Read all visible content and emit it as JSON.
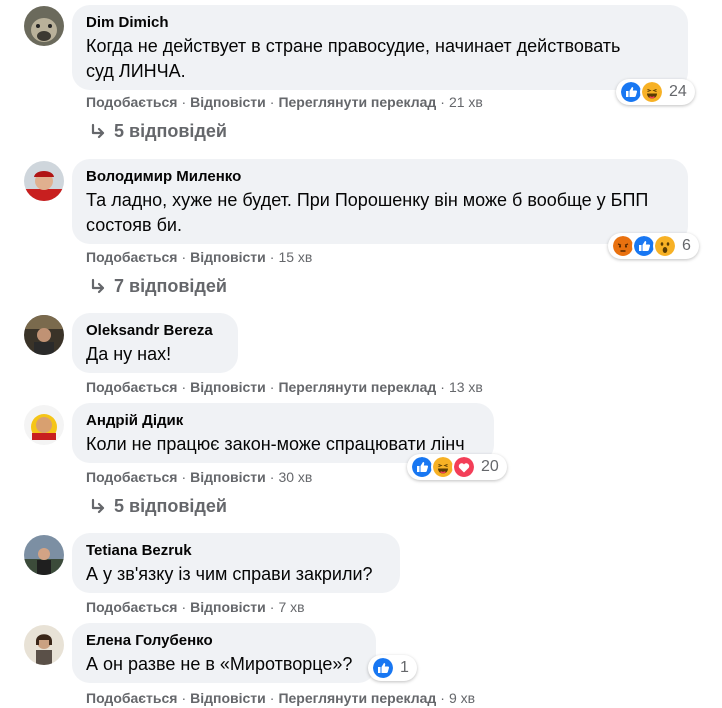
{
  "colors": {
    "bubble": "#f0f2f5",
    "secondary_text": "#65676b",
    "like_blue": "#1877f2",
    "haha_yellow": "#f7b125",
    "angry_orange": "#e9710f",
    "love_red": "#f33e58"
  },
  "comments": [
    {
      "author": "Dim Dimich",
      "text_lines": [
        "Когда не действует в стране правосудие, начинает действовать",
        "суд ЛИНЧА."
      ],
      "actions": [
        "Подобається",
        "Відповісти",
        "Переглянути переклад"
      ],
      "time": "21 хв",
      "reactions": {
        "icons": [
          "like-icon",
          "haha-icon"
        ],
        "count": "24"
      },
      "replies": "5 відповідей"
    },
    {
      "author": "Володимир Миленко",
      "text_lines": [
        "Та ладно, хуже не будет. При Порошенку він може б вообще у БПП",
        "состояв би."
      ],
      "actions": [
        "Подобається",
        "Відповісти"
      ],
      "time": "15 хв",
      "reactions": {
        "icons": [
          "angry-icon",
          "like-icon",
          "wow-icon"
        ],
        "count": "6"
      },
      "replies": "7 відповідей"
    },
    {
      "author": "Oleksandr Bereza",
      "text_lines": [
        "Да ну нах!"
      ],
      "actions": [
        "Подобається",
        "Відповісти",
        "Переглянути переклад"
      ],
      "time": "13 хв"
    },
    {
      "author": "Андрій Дідик",
      "text_lines": [
        "Коли не працює закон-може спрацювати лінч"
      ],
      "actions": [
        "Подобається",
        "Відповісти"
      ],
      "time": "30 хв",
      "reactions": {
        "icons": [
          "like-icon",
          "haha-icon",
          "love-icon"
        ],
        "count": "20"
      },
      "replies": "5 відповідей"
    },
    {
      "author": "Tetiana Bezruk",
      "text_lines": [
        "А у зв'язку із чим справи закрили?"
      ],
      "actions": [
        "Подобається",
        "Відповісти"
      ],
      "time": "7 хв"
    },
    {
      "author": "Елена Голубенко",
      "text_lines": [
        "А он разве не в «Миротворце»?"
      ],
      "actions": [
        "Подобається",
        "Відповісти",
        "Переглянути переклад"
      ],
      "time": "9 хв",
      "reactions": {
        "icons": [
          "like-icon"
        ],
        "count": "1"
      }
    }
  ]
}
